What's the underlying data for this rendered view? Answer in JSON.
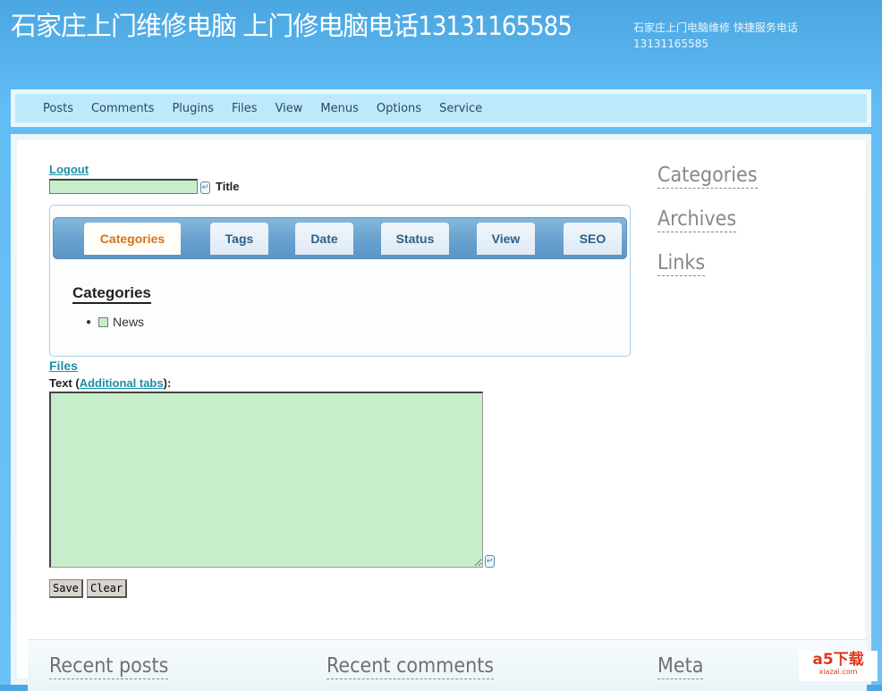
{
  "header": {
    "title": "石家庄上门维修电脑 上门修电脑电话13131165585",
    "tagline": "石家庄上门电脑维修 快捷服务电话 13131165585"
  },
  "nav": [
    "Posts",
    "Comments",
    "Plugins",
    "Files",
    "View",
    "Menus",
    "Options",
    "Service"
  ],
  "form": {
    "logout": "Logout",
    "title_label": "Title",
    "title_value": "",
    "tabs": [
      "Categories",
      "Tags",
      "Date",
      "Status",
      "View",
      "SEO"
    ],
    "categories_heading": "Categories",
    "category_item": "News",
    "files_link": "Files",
    "text_label_prefix": "Text (",
    "text_label_link": "Additional tabs",
    "text_label_suffix": "):",
    "text_value": "",
    "save": "Save",
    "clear": "Clear"
  },
  "sidebar": [
    "Categories",
    "Archives",
    "Links"
  ],
  "footer": [
    "Recent posts",
    "Recent comments",
    "Meta"
  ],
  "watermark": {
    "logo": "a5下载",
    "site": "xiazai.com"
  }
}
